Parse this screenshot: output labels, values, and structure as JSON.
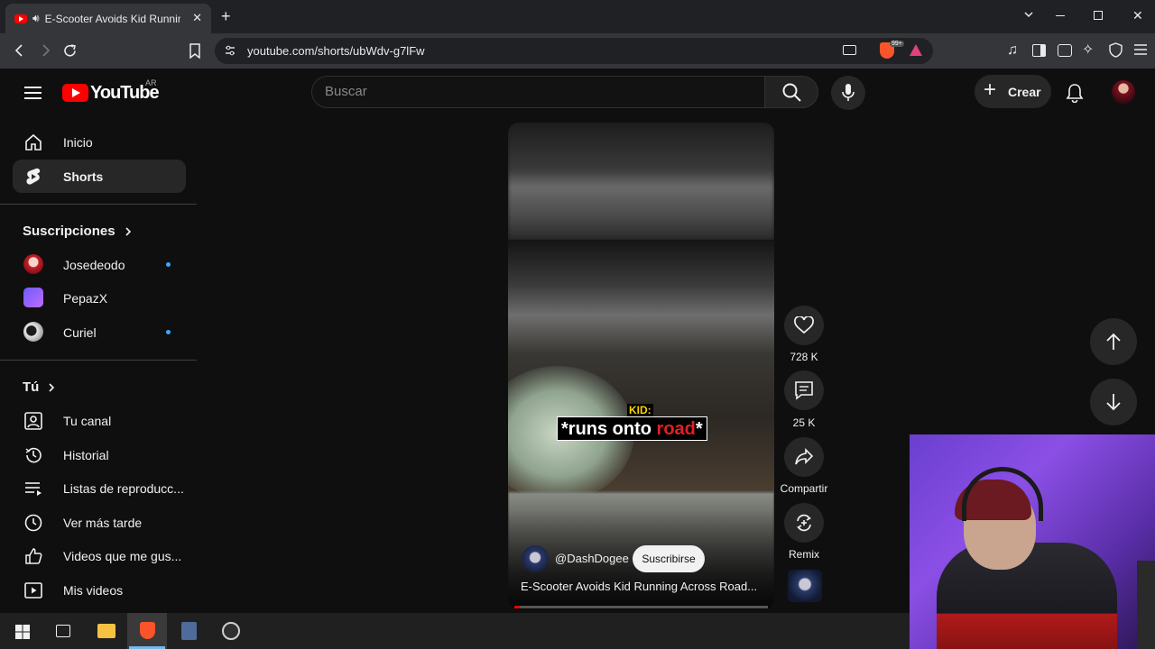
{
  "browser": {
    "tab_title": "E-Scooter Avoids Kid Running",
    "url": "youtube.com/shorts/ubWdv-g7lFw",
    "brave_badge": "99+"
  },
  "youtube": {
    "logo_text": "YouTube",
    "region": "AR",
    "search_placeholder": "Buscar",
    "create_label": "Crear"
  },
  "sidebar": {
    "main": [
      {
        "label": "Inicio",
        "icon": "home-icon"
      },
      {
        "label": "Shorts",
        "icon": "shorts-icon",
        "active": true
      }
    ],
    "subscriptions_title": "Suscripciones",
    "subscriptions": [
      {
        "label": "Josedeodo",
        "new": true
      },
      {
        "label": "PepazX",
        "new": false
      },
      {
        "label": "Curiel",
        "new": true
      }
    ],
    "you_title": "Tú",
    "you_items": [
      {
        "label": "Tu canal",
        "icon": "your-channel-icon"
      },
      {
        "label": "Historial",
        "icon": "history-icon"
      },
      {
        "label": "Listas de reproducc...",
        "icon": "playlists-icon"
      },
      {
        "label": "Ver más tarde",
        "icon": "watch-later-icon"
      },
      {
        "label": "Videos que me gus...",
        "icon": "liked-icon"
      },
      {
        "label": "Mis videos",
        "icon": "my-videos-icon"
      }
    ]
  },
  "short": {
    "caption_top": "KID:",
    "caption_white": "*runs onto ",
    "caption_red": "road",
    "caption_end": "*",
    "channel": "@DashDogee",
    "subscribe_label": "Suscribirse",
    "title": "E-Scooter Avoids Kid Running Across Road...",
    "likes": "728 K",
    "comments": "25 K",
    "share_label": "Compartir",
    "remix_label": "Remix",
    "progress": 0.02
  },
  "colors": {
    "yt_red": "#ff0000",
    "accent_blue": "#3ea6ff",
    "bg": "#0f0f0f"
  }
}
